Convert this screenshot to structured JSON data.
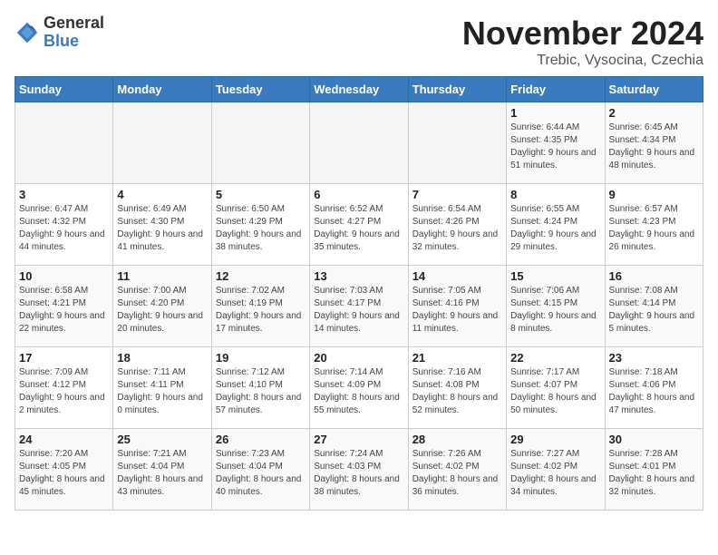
{
  "logo": {
    "general": "General",
    "blue": "Blue"
  },
  "title": "November 2024",
  "subtitle": "Trebic, Vysocina, Czechia",
  "days_header": [
    "Sunday",
    "Monday",
    "Tuesday",
    "Wednesday",
    "Thursday",
    "Friday",
    "Saturday"
  ],
  "weeks": [
    [
      {
        "day": "",
        "info": ""
      },
      {
        "day": "",
        "info": ""
      },
      {
        "day": "",
        "info": ""
      },
      {
        "day": "",
        "info": ""
      },
      {
        "day": "",
        "info": ""
      },
      {
        "day": "1",
        "info": "Sunrise: 6:44 AM\nSunset: 4:35 PM\nDaylight: 9 hours and 51 minutes."
      },
      {
        "day": "2",
        "info": "Sunrise: 6:45 AM\nSunset: 4:34 PM\nDaylight: 9 hours and 48 minutes."
      }
    ],
    [
      {
        "day": "3",
        "info": "Sunrise: 6:47 AM\nSunset: 4:32 PM\nDaylight: 9 hours and 44 minutes."
      },
      {
        "day": "4",
        "info": "Sunrise: 6:49 AM\nSunset: 4:30 PM\nDaylight: 9 hours and 41 minutes."
      },
      {
        "day": "5",
        "info": "Sunrise: 6:50 AM\nSunset: 4:29 PM\nDaylight: 9 hours and 38 minutes."
      },
      {
        "day": "6",
        "info": "Sunrise: 6:52 AM\nSunset: 4:27 PM\nDaylight: 9 hours and 35 minutes."
      },
      {
        "day": "7",
        "info": "Sunrise: 6:54 AM\nSunset: 4:26 PM\nDaylight: 9 hours and 32 minutes."
      },
      {
        "day": "8",
        "info": "Sunrise: 6:55 AM\nSunset: 4:24 PM\nDaylight: 9 hours and 29 minutes."
      },
      {
        "day": "9",
        "info": "Sunrise: 6:57 AM\nSunset: 4:23 PM\nDaylight: 9 hours and 26 minutes."
      }
    ],
    [
      {
        "day": "10",
        "info": "Sunrise: 6:58 AM\nSunset: 4:21 PM\nDaylight: 9 hours and 22 minutes."
      },
      {
        "day": "11",
        "info": "Sunrise: 7:00 AM\nSunset: 4:20 PM\nDaylight: 9 hours and 20 minutes."
      },
      {
        "day": "12",
        "info": "Sunrise: 7:02 AM\nSunset: 4:19 PM\nDaylight: 9 hours and 17 minutes."
      },
      {
        "day": "13",
        "info": "Sunrise: 7:03 AM\nSunset: 4:17 PM\nDaylight: 9 hours and 14 minutes."
      },
      {
        "day": "14",
        "info": "Sunrise: 7:05 AM\nSunset: 4:16 PM\nDaylight: 9 hours and 11 minutes."
      },
      {
        "day": "15",
        "info": "Sunrise: 7:06 AM\nSunset: 4:15 PM\nDaylight: 9 hours and 8 minutes."
      },
      {
        "day": "16",
        "info": "Sunrise: 7:08 AM\nSunset: 4:14 PM\nDaylight: 9 hours and 5 minutes."
      }
    ],
    [
      {
        "day": "17",
        "info": "Sunrise: 7:09 AM\nSunset: 4:12 PM\nDaylight: 9 hours and 2 minutes."
      },
      {
        "day": "18",
        "info": "Sunrise: 7:11 AM\nSunset: 4:11 PM\nDaylight: 9 hours and 0 minutes."
      },
      {
        "day": "19",
        "info": "Sunrise: 7:12 AM\nSunset: 4:10 PM\nDaylight: 8 hours and 57 minutes."
      },
      {
        "day": "20",
        "info": "Sunrise: 7:14 AM\nSunset: 4:09 PM\nDaylight: 8 hours and 55 minutes."
      },
      {
        "day": "21",
        "info": "Sunrise: 7:16 AM\nSunset: 4:08 PM\nDaylight: 8 hours and 52 minutes."
      },
      {
        "day": "22",
        "info": "Sunrise: 7:17 AM\nSunset: 4:07 PM\nDaylight: 8 hours and 50 minutes."
      },
      {
        "day": "23",
        "info": "Sunrise: 7:18 AM\nSunset: 4:06 PM\nDaylight: 8 hours and 47 minutes."
      }
    ],
    [
      {
        "day": "24",
        "info": "Sunrise: 7:20 AM\nSunset: 4:05 PM\nDaylight: 8 hours and 45 minutes."
      },
      {
        "day": "25",
        "info": "Sunrise: 7:21 AM\nSunset: 4:04 PM\nDaylight: 8 hours and 43 minutes."
      },
      {
        "day": "26",
        "info": "Sunrise: 7:23 AM\nSunset: 4:04 PM\nDaylight: 8 hours and 40 minutes."
      },
      {
        "day": "27",
        "info": "Sunrise: 7:24 AM\nSunset: 4:03 PM\nDaylight: 8 hours and 38 minutes."
      },
      {
        "day": "28",
        "info": "Sunrise: 7:26 AM\nSunset: 4:02 PM\nDaylight: 8 hours and 36 minutes."
      },
      {
        "day": "29",
        "info": "Sunrise: 7:27 AM\nSunset: 4:02 PM\nDaylight: 8 hours and 34 minutes."
      },
      {
        "day": "30",
        "info": "Sunrise: 7:28 AM\nSunset: 4:01 PM\nDaylight: 8 hours and 32 minutes."
      }
    ]
  ]
}
